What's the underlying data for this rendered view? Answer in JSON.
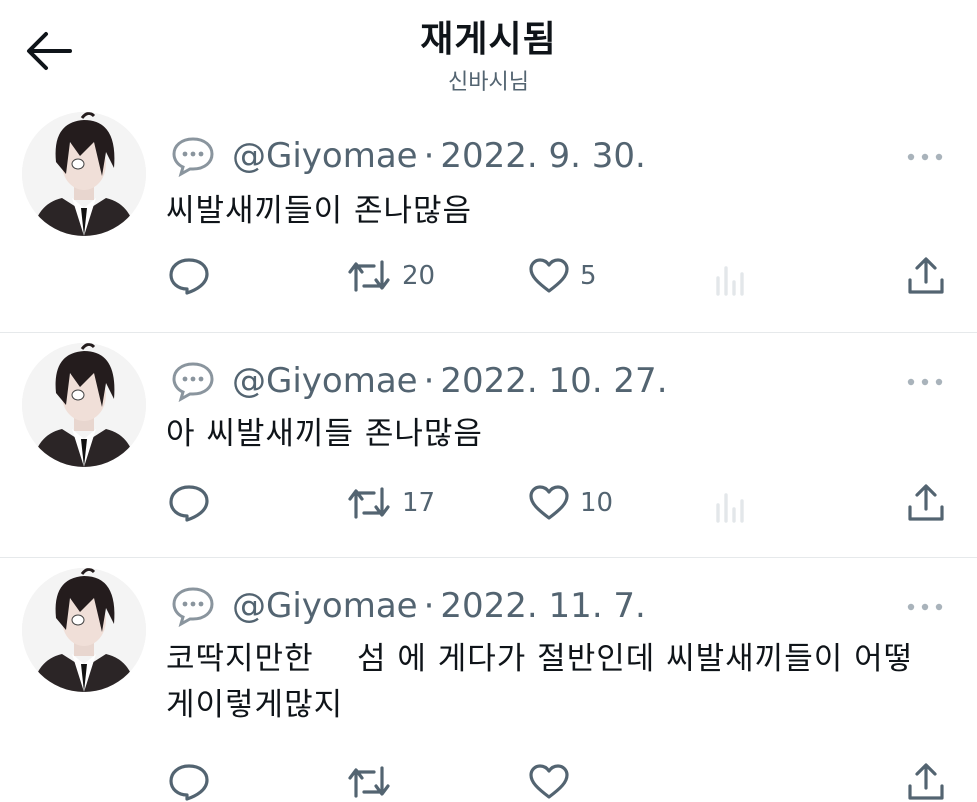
{
  "header": {
    "title": "재게시됨",
    "subtitle": "신바시님"
  },
  "tweets": [
    {
      "handle": "@Giyomae",
      "separator": "·",
      "date": "2022. 9. 30.",
      "text": "씨발새끼들이 존나많음",
      "retweets": "20",
      "likes": "5"
    },
    {
      "handle": "@Giyomae",
      "separator": "·",
      "date": "2022. 10. 27.",
      "text": "아 씨발새끼들 존나많음",
      "retweets": "17",
      "likes": "10"
    },
    {
      "handle": "@Giyomae",
      "separator": "·",
      "date": "2022. 11. 7.",
      "text": "코딱지만한    섬 에 게다가 절반인데 씨발새끼들이 어떻게이렇게많지",
      "retweets": "",
      "likes": ""
    }
  ],
  "icons": {
    "back": "arrow-left-icon",
    "reply": "speech-bubble-icon",
    "retweet": "retweet-icon",
    "like": "heart-icon",
    "views": "bar-chart-icon",
    "share": "share-upload-icon",
    "more": "more-dots-icon"
  },
  "colors": {
    "text": "#0f1419",
    "secondary": "#536471",
    "divider": "#e6e9eb"
  }
}
